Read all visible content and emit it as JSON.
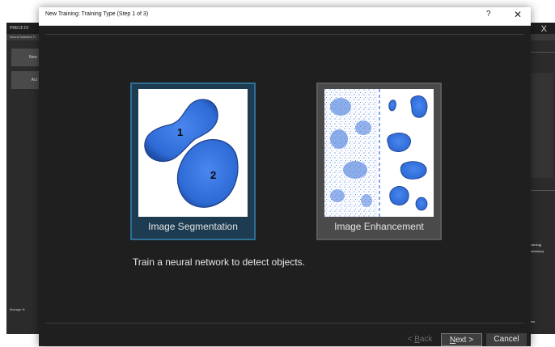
{
  "background_app": {
    "title": "PRECII DI",
    "subtitle": "Neural Network Tr",
    "window_controls": "? — X",
    "buttons": [
      "New",
      "Act"
    ],
    "manage_label": "Manage N",
    "right_panel_texts": [
      "raining)",
      "alidation)"
    ],
    "right_footer": "ew"
  },
  "dialog": {
    "title": "New Training: Training Type (Step 1 of 3)",
    "help_label": "?",
    "close_label": "✕",
    "options": [
      {
        "label": "Image Segmentation",
        "selected": true,
        "badge_1": "1",
        "badge_2": "2"
      },
      {
        "label": "Image Enhancement",
        "selected": false
      }
    ],
    "description": "Train a neural network to detect objects.",
    "buttons": {
      "back_prefix": "< ",
      "back_key": "B",
      "back_rest": "ack",
      "next_key": "N",
      "next_rest": "ext >",
      "cancel": "Cancel"
    }
  },
  "colors": {
    "dialog_bg": "#1f1f1f",
    "selected_card": "#1d3c52",
    "selected_border": "#2f6f96",
    "blob_blue": "#2f6bd6"
  }
}
